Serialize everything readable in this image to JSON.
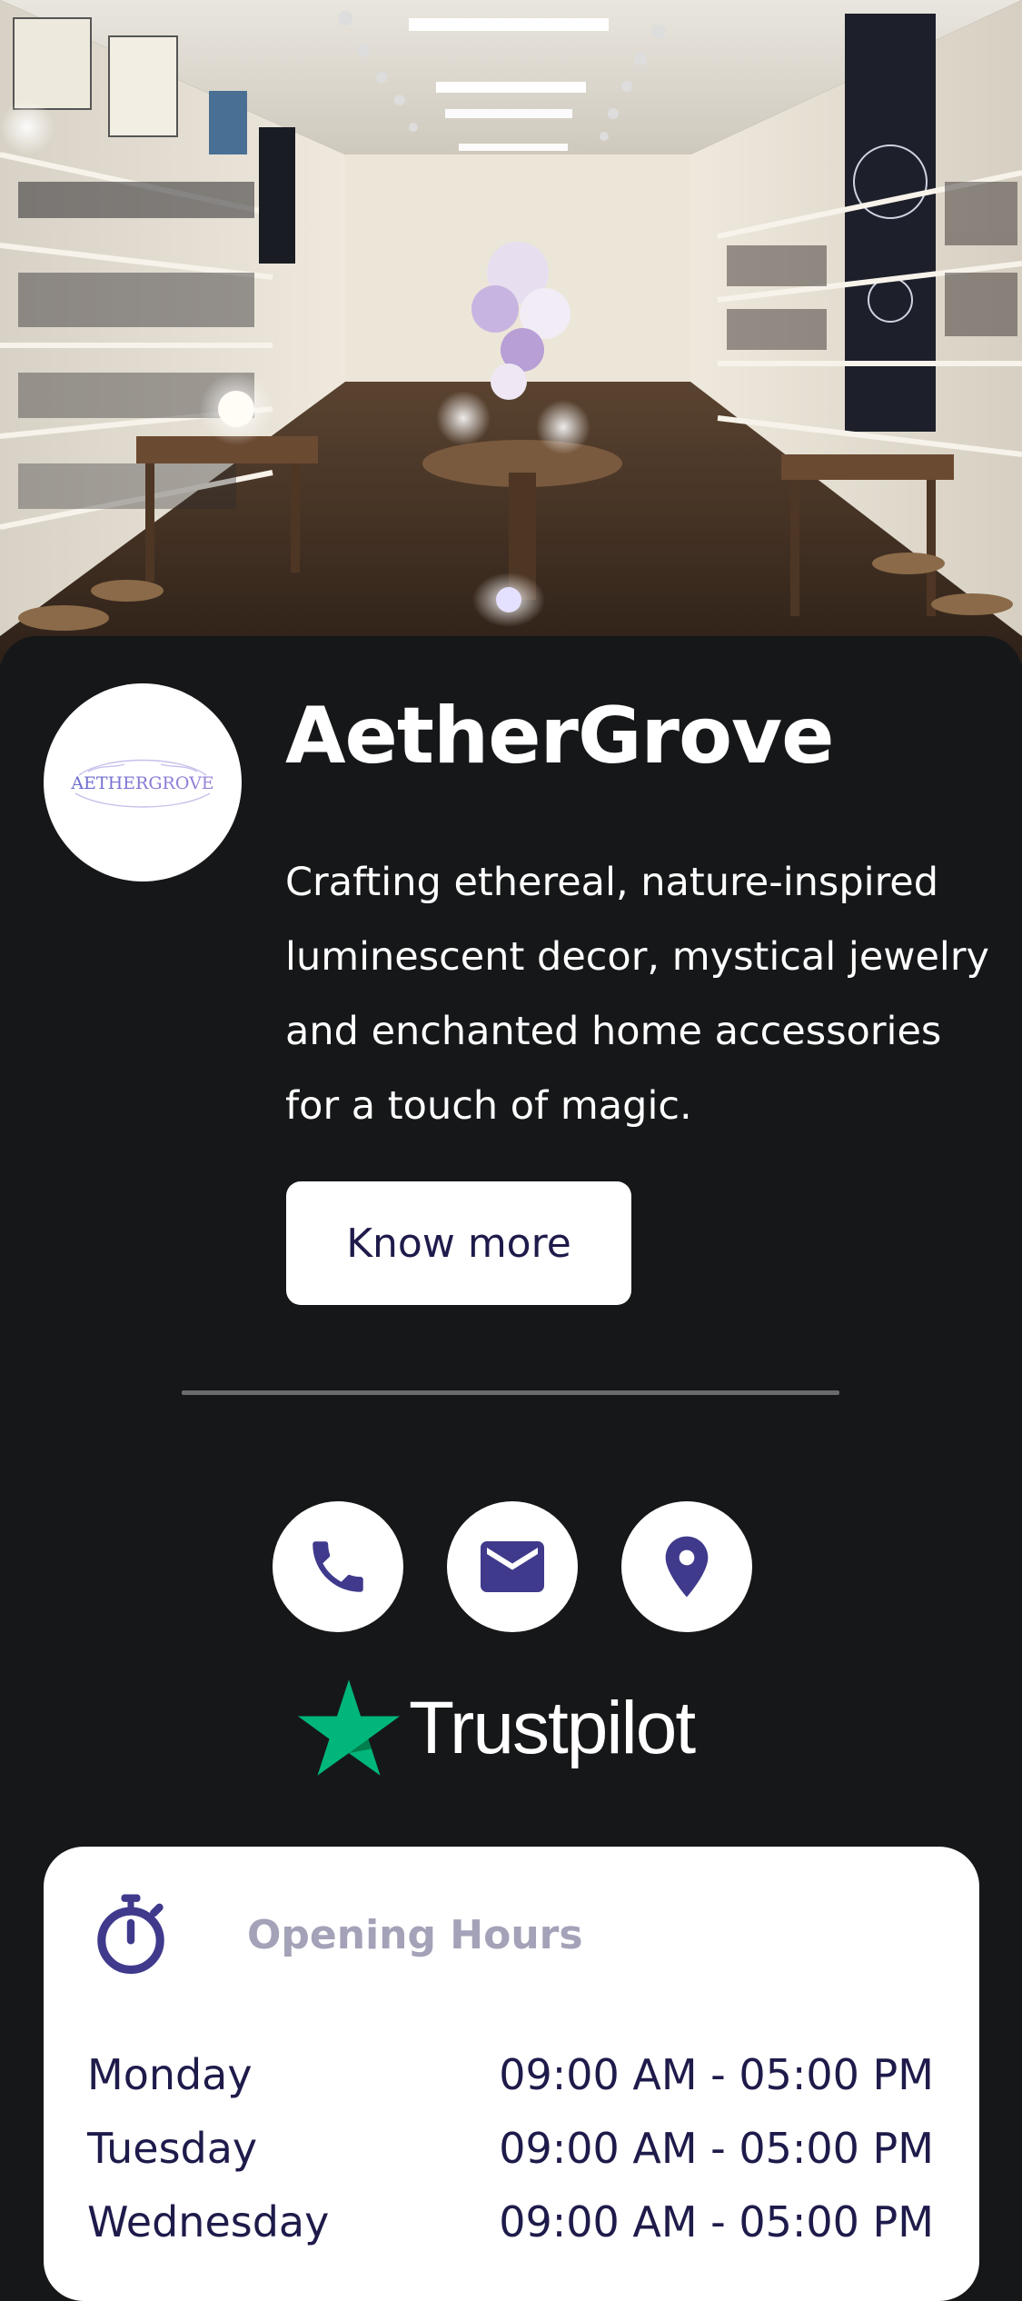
{
  "brand": {
    "name": "AetherGrove",
    "logo_text": "AETHERGROVE",
    "tagline": "Crafting ethereal, nature-inspired luminescent decor, mystical jewelry and enchanted home accessories for a touch of magic.",
    "cta_label": "Know more"
  },
  "contact": {
    "phone_icon": "phone-icon",
    "email_icon": "mail-icon",
    "location_icon": "map-pin-icon"
  },
  "trustpilot": {
    "label": "Trustpilot",
    "star_color": "#00b67a"
  },
  "opening_hours": {
    "title": "Opening Hours",
    "icon": "stopwatch-icon",
    "rows": [
      {
        "day": "Monday",
        "hours": "09:00 AM - 05:00 PM"
      },
      {
        "day": "Tuesday",
        "hours": "09:00 AM - 05:00 PM"
      },
      {
        "day": "Wednesday",
        "hours": "09:00 AM - 05:00 PM"
      }
    ]
  },
  "colors": {
    "background": "#161718",
    "accent": "#3f3a8c",
    "button_text": "#1e1b4b",
    "muted_title": "#a3a2b8"
  }
}
